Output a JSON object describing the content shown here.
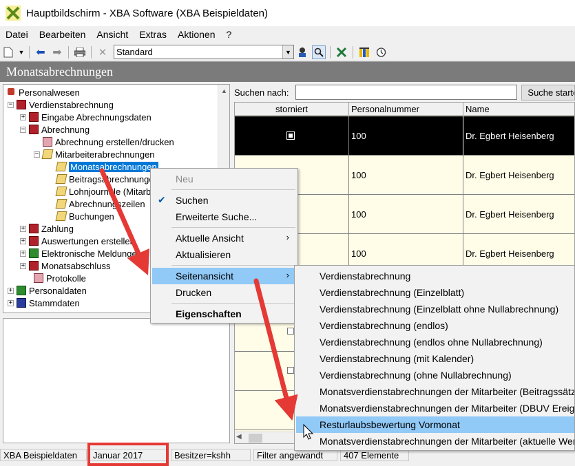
{
  "window": {
    "title": "Hauptbildschirm - XBA Software (XBA Beispieldaten)"
  },
  "menubar": [
    "Datei",
    "Bearbeiten",
    "Ansicht",
    "Extras",
    "Aktionen",
    "?"
  ],
  "toolbar": {
    "view_select": "Standard"
  },
  "section": {
    "title": "Monatsabrechnungen"
  },
  "tree": {
    "items": [
      {
        "label": "Personalwesen"
      },
      {
        "label": "Verdienstabrechnung"
      },
      {
        "label": "Eingabe Abrechnungsdaten"
      },
      {
        "label": "Abrechnung"
      },
      {
        "label": "Abrechnung erstellen/drucken"
      },
      {
        "label": "Mitarbeiterabrechnungen"
      },
      {
        "label": "Monatsabrechnungen"
      },
      {
        "label": "Beitragsabrechnungen"
      },
      {
        "label": "Lohnjournale (Mitarbeiter)"
      },
      {
        "label": "Abrechnungszeilen"
      },
      {
        "label": "Buchungen"
      },
      {
        "label": "Zahlung"
      },
      {
        "label": "Auswertungen erstellen"
      },
      {
        "label": "Elektronische Meldungen"
      },
      {
        "label": "Monatsabschluss"
      },
      {
        "label": "Protokolle"
      },
      {
        "label": "Personaldaten"
      },
      {
        "label": "Stammdaten"
      }
    ]
  },
  "search": {
    "label": "Suchen nach:",
    "button": "Suche starten"
  },
  "grid": {
    "columns": [
      "storniert",
      "Personalnummer",
      "Name"
    ],
    "rows": [
      {
        "personalnummer": "100",
        "name": "Dr. Egbert Heisenberg"
      },
      {
        "personalnummer": "100",
        "name": "Dr. Egbert Heisenberg"
      },
      {
        "personalnummer": "100",
        "name": "Dr. Egbert Heisenberg"
      },
      {
        "personalnummer": "100",
        "name": "Dr. Egbert Heisenberg"
      }
    ]
  },
  "context_menu": {
    "items": [
      "Neu",
      "Suchen",
      "Erweiterte Suche...",
      "Aktuelle Ansicht",
      "Aktualisieren",
      "Seitenansicht",
      "Drucken",
      "Eigenschaften"
    ]
  },
  "submenu": {
    "items": [
      "Verdienstabrechnung",
      "Verdienstabrechnung (Einzelblatt)",
      "Verdienstabrechnung (Einzelblatt ohne Nullabrechnung)",
      "Verdienstabrechnung (endlos)",
      "Verdienstabrechnung (endlos ohne Nullabrechnung)",
      "Verdienstabrechnung (mit Kalender)",
      "Verdienstabrechnung (ohne Nullabrechnung)",
      "Monatsverdienstabrechnungen der Mitarbeiter (Beitragssätze)",
      "Monatsverdienstabrechnungen der Mitarbeiter (DBUV Ereignisse)",
      "Resturlaubsbewertung Vormonat",
      "Monatsverdienstabrechnungen der Mitarbeiter (aktuelle Werte)"
    ]
  },
  "statusbar": {
    "database": "XBA Beispieldaten",
    "period": "Januar 2017",
    "owner": "Besitzer=kshh",
    "filter": "Filter angewandt",
    "count": "407 Elemente"
  },
  "colors": {
    "accent": "#0078d7",
    "highlight": "#91c9f7",
    "annotation": "#e53935",
    "header": "#7b7b7b"
  }
}
